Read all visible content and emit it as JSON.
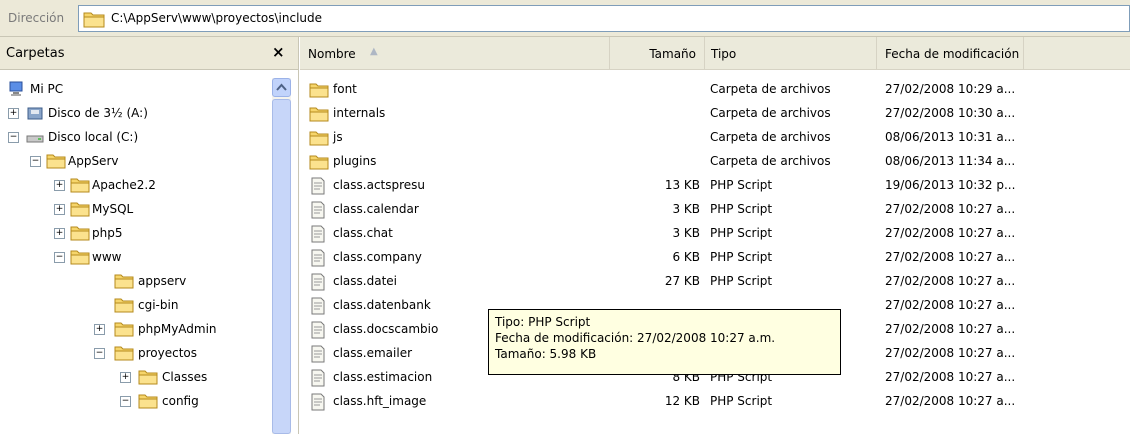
{
  "address": {
    "label": "Dirección",
    "path": "C:\\AppServ\\www\\proyectos\\include"
  },
  "folders_pane": {
    "title": "Carpetas",
    "close_glyph": "×",
    "tree": [
      {
        "label": "Mi PC",
        "icon": "computer-icon",
        "expander": ""
      },
      {
        "label": "Disco de 3½ (A:)",
        "icon": "floppy-icon",
        "expander": "+"
      },
      {
        "label": "Disco local (C:)",
        "icon": "drive-icon",
        "expander": "−"
      },
      {
        "label": "AppServ",
        "icon": "folder-icon",
        "expander": "−"
      },
      {
        "label": "Apache2.2",
        "icon": "folder-icon",
        "expander": "+"
      },
      {
        "label": "MySQL",
        "icon": "folder-icon",
        "expander": "+"
      },
      {
        "label": "php5",
        "icon": "folder-icon",
        "expander": "+"
      },
      {
        "label": "www",
        "icon": "folder-icon",
        "expander": "−"
      },
      {
        "label": "appserv",
        "icon": "folder-icon",
        "expander": ""
      },
      {
        "label": "cgi-bin",
        "icon": "folder-icon",
        "expander": ""
      },
      {
        "label": "phpMyAdmin",
        "icon": "folder-icon",
        "expander": "+"
      },
      {
        "label": "proyectos",
        "icon": "folder-icon",
        "expander": "−"
      },
      {
        "label": "Classes",
        "icon": "folder-icon",
        "expander": "+"
      },
      {
        "label": "config",
        "icon": "folder-icon",
        "expander": "−"
      }
    ]
  },
  "columns": {
    "name": "Nombre",
    "size": "Tamaño",
    "type": "Tipo",
    "modified": "Fecha de modificación"
  },
  "files": [
    {
      "name": "font",
      "size": "",
      "type": "Carpeta de archivos",
      "modified": "27/02/2008 10:29 a...",
      "icon": "folder-icon"
    },
    {
      "name": "internals",
      "size": "",
      "type": "Carpeta de archivos",
      "modified": "27/02/2008 10:30 a...",
      "icon": "folder-icon"
    },
    {
      "name": "js",
      "size": "",
      "type": "Carpeta de archivos",
      "modified": "08/06/2013 10:31 a...",
      "icon": "folder-icon"
    },
    {
      "name": "plugins",
      "size": "",
      "type": "Carpeta de archivos",
      "modified": "08/06/2013 11:34 a...",
      "icon": "folder-icon"
    },
    {
      "name": "class.actspresu",
      "size": "13 KB",
      "type": "PHP Script",
      "modified": "19/06/2013 10:32 p...",
      "icon": "php-file-icon"
    },
    {
      "name": "class.calendar",
      "size": "3 KB",
      "type": "PHP Script",
      "modified": "27/02/2008 10:27 a...",
      "icon": "php-file-icon"
    },
    {
      "name": "class.chat",
      "size": "3 KB",
      "type": "PHP Script",
      "modified": "27/02/2008 10:27 a...",
      "icon": "php-file-icon"
    },
    {
      "name": "class.company",
      "size": "6 KB",
      "type": "PHP Script",
      "modified": "27/02/2008 10:27 a...",
      "icon": "php-file-icon"
    },
    {
      "name": "class.datei",
      "size": "27 KB",
      "type": "PHP Script",
      "modified": "27/02/2008 10:27 a...",
      "icon": "php-file-icon"
    },
    {
      "name": "class.datenbank",
      "size": "",
      "type": "",
      "modified": "27/02/2008 10:27 a...",
      "icon": "php-file-icon"
    },
    {
      "name": "class.docscambio",
      "size": "",
      "type": "",
      "modified": "27/02/2008 10:27 a...",
      "icon": "php-file-icon"
    },
    {
      "name": "class.emailer",
      "size": "",
      "type": "",
      "modified": "27/02/2008 10:27 a...",
      "icon": "php-file-icon"
    },
    {
      "name": "class.estimacion",
      "size": "8 KB",
      "type": "PHP Script",
      "modified": "27/02/2008 10:27 a...",
      "icon": "php-file-icon"
    },
    {
      "name": "class.hft_image",
      "size": "12 KB",
      "type": "PHP Script",
      "modified": "27/02/2008 10:27 a...",
      "icon": "php-file-icon"
    }
  ],
  "tooltip": {
    "line1": "Tipo: PHP Script",
    "line2": "Fecha de modificación: 27/02/2008 10:27 a.m.",
    "line3": "Tamaño: 5.98 KB"
  },
  "colors": {
    "chrome": "#ece9d8",
    "folder": "#f6d56b",
    "tooltip_bg": "#ffffe1"
  }
}
